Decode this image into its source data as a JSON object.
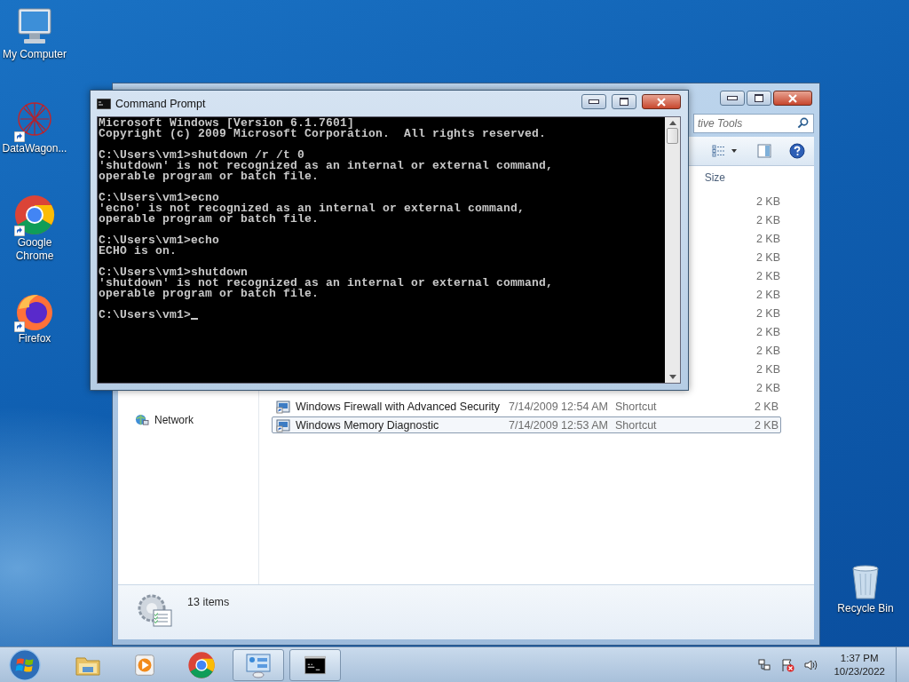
{
  "desktop_icons": [
    {
      "kind": "computer",
      "label": "My Computer",
      "shortcut": false
    },
    {
      "kind": "network-art",
      "label": "DataWagon...",
      "shortcut": true
    },
    {
      "kind": "chrome",
      "label": "Google Chrome",
      "shortcut": true
    },
    {
      "kind": "firefox",
      "label": "Firefox",
      "shortcut": true
    },
    {
      "kind": "recycle",
      "label": "Recycle Bin",
      "shortcut": false
    }
  ],
  "explorer": {
    "search": {
      "placeholder": "tive Tools"
    },
    "columns": [
      {
        "label": "Size"
      }
    ],
    "nav": [
      {
        "label": "Network"
      }
    ],
    "rows": [
      {
        "size": "2 KB",
        "selected": false
      },
      {
        "size": "2 KB",
        "selected": false
      },
      {
        "size": "2 KB",
        "selected": false
      },
      {
        "size": "2 KB",
        "selected": false
      },
      {
        "size": "2 KB",
        "selected": false
      },
      {
        "size": "2 KB",
        "selected": false
      },
      {
        "size": "2 KB",
        "selected": false
      },
      {
        "size": "2 KB",
        "selected": false
      },
      {
        "size": "2 KB",
        "selected": false
      },
      {
        "size": "2 KB",
        "selected": false
      },
      {
        "size": "2 KB",
        "selected": false
      },
      {
        "name": "Windows Firewall with Advanced Security",
        "date": "7/14/2009 12:54 AM",
        "type": "Shortcut",
        "size": "2 KB",
        "selected": false
      },
      {
        "name": "Windows Memory Diagnostic",
        "date": "7/14/2009 12:53 AM",
        "type": "Shortcut",
        "size": "2 KB",
        "selected": true
      }
    ],
    "status": "13 items"
  },
  "console": {
    "title": "Command Prompt",
    "blocks": [
      [
        "Microsoft Windows [Version 6.1.7601]",
        "Copyright (c) 2009 Microsoft Corporation.  All rights reserved."
      ],
      [
        "C:\\Users\\vm1>shutdown /r /t 0",
        "'shutdown' is not recognized as an internal or external command,",
        "operable program or batch file."
      ],
      [
        "C:\\Users\\vm1>ecno",
        "'ecno' is not recognized as an internal or external command,",
        "operable program or batch file."
      ],
      [
        "C:\\Users\\vm1>echo",
        "ECHO is on."
      ],
      [
        "C:\\Users\\vm1>shutdown",
        "'shutdown' is not recognized as an internal or external command,",
        "operable program or batch file."
      ],
      [
        "C:\\Users\\vm1>"
      ]
    ],
    "cursor": true
  },
  "taskbar": {
    "items": [
      {
        "kind": "folder",
        "open": false
      },
      {
        "kind": "media",
        "open": false
      },
      {
        "kind": "chrome",
        "open": false
      },
      {
        "kind": "control-panel",
        "open": true
      },
      {
        "kind": "console",
        "open": true
      }
    ],
    "time": "1:37 PM",
    "date": "10/23/2022"
  }
}
